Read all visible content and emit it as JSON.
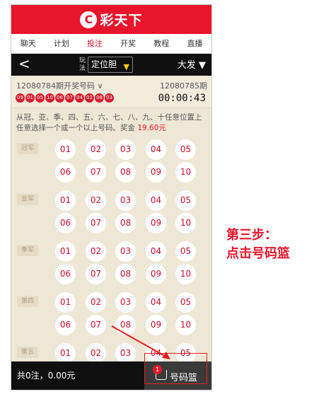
{
  "brand": {
    "logo_glyph": "C",
    "name": "彩天下"
  },
  "nav": [
    "聊天",
    "计划",
    "投注",
    "开奖",
    "教程",
    "直播"
  ],
  "nav_active_index": 2,
  "titlebar": {
    "back_glyph": "<",
    "play_label": "玩法",
    "mode": "定位胆",
    "game": "大发"
  },
  "draw": {
    "prev_period": "12080784期开奖号码",
    "next_period": "12080785期",
    "balls": [
      "09",
      "01",
      "05",
      "10",
      "06",
      "07",
      "04",
      "02",
      "08",
      "03"
    ],
    "countdown": "00:00:43"
  },
  "rule": {
    "text": "从冠、亚、季、四、五、六、七、八、九、十任意位置上任意选择一个或一个以上号码。奖金",
    "prize": "19.60元"
  },
  "positions": [
    "冠军",
    "亚军",
    "季军",
    "第四",
    "第五"
  ],
  "numbers": [
    "01",
    "02",
    "03",
    "04",
    "05",
    "06",
    "07",
    "08",
    "09",
    "10"
  ],
  "footer": {
    "summary": "共0注，0.00元",
    "cart_count": "1",
    "cart_label": "号码篮"
  },
  "annotation": {
    "line1": "第三步：",
    "line2": "点击号码篮"
  },
  "colors": {
    "brand_red": "#e8152c",
    "ball_red": "#d61b2d",
    "bg_beige": "#efe7d6"
  }
}
